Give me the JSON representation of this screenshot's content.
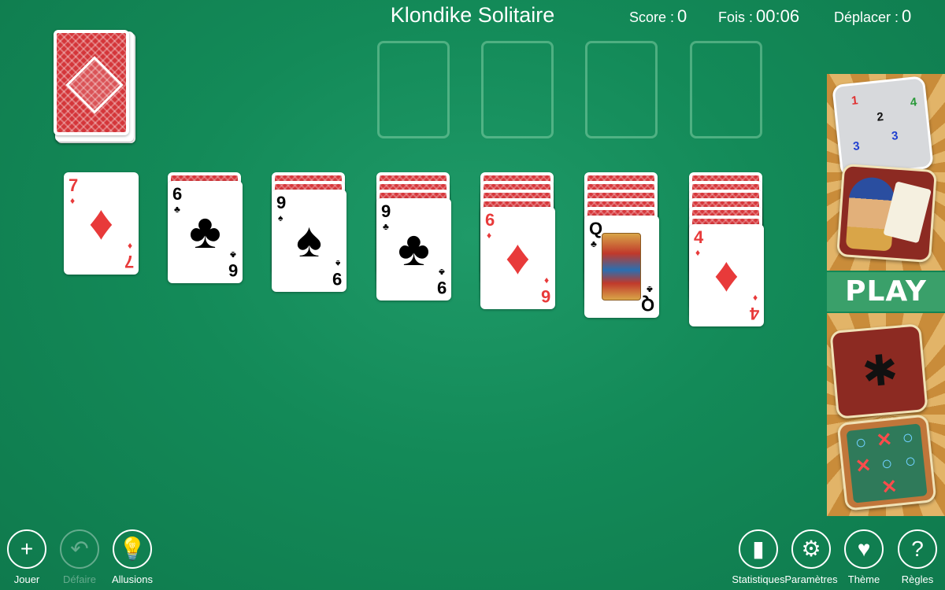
{
  "header": {
    "title": "Klondike Solitaire",
    "score_label": "Score :",
    "score_value": "0",
    "time_label": "Fois :",
    "time_value": "00:06",
    "moves_label": "Déplacer :",
    "moves_value": "0"
  },
  "tableau": [
    {
      "rank": "7",
      "suit": "♦",
      "color": "red",
      "hidden": 0
    },
    {
      "rank": "6",
      "suit": "♣",
      "color": "black",
      "hidden": 1
    },
    {
      "rank": "9",
      "suit": "♠",
      "color": "black",
      "hidden": 2
    },
    {
      "rank": "9",
      "suit": "♣",
      "color": "black",
      "hidden": 3
    },
    {
      "rank": "6",
      "suit": "♦",
      "color": "red",
      "hidden": 4
    },
    {
      "rank": "Q",
      "suit": "♣",
      "color": "black",
      "hidden": 5
    },
    {
      "rank": "4",
      "suit": "♦",
      "color": "red",
      "hidden": 6
    }
  ],
  "sidebar": {
    "play_label": "PLAY",
    "minesweeper_cells": [
      "1",
      "2",
      "4",
      "3",
      "3"
    ]
  },
  "toolbar_left": [
    {
      "icon": "plus-icon",
      "glyph": "+",
      "label": "Jouer",
      "enabled": true
    },
    {
      "icon": "undo-icon",
      "glyph": "↶",
      "label": "Défaire",
      "enabled": false
    },
    {
      "icon": "lightbulb-icon",
      "glyph": "💡",
      "label": "Allusions",
      "enabled": true
    }
  ],
  "toolbar_right": [
    {
      "icon": "bar-chart-icon",
      "glyph": "▮",
      "label": "Statistiques",
      "enabled": true
    },
    {
      "icon": "gear-icon",
      "glyph": "⚙",
      "label": "Paramètres",
      "enabled": true
    },
    {
      "icon": "theme-cards-icon",
      "glyph": "♥",
      "label": "Thème",
      "enabled": true
    },
    {
      "icon": "question-icon",
      "glyph": "?",
      "label": "Règles",
      "enabled": true
    }
  ],
  "colors": {
    "felt": "#138a58",
    "card_back": "#d4363a",
    "red_suit": "#e83a3a",
    "play_strip": "#3aa06a"
  }
}
